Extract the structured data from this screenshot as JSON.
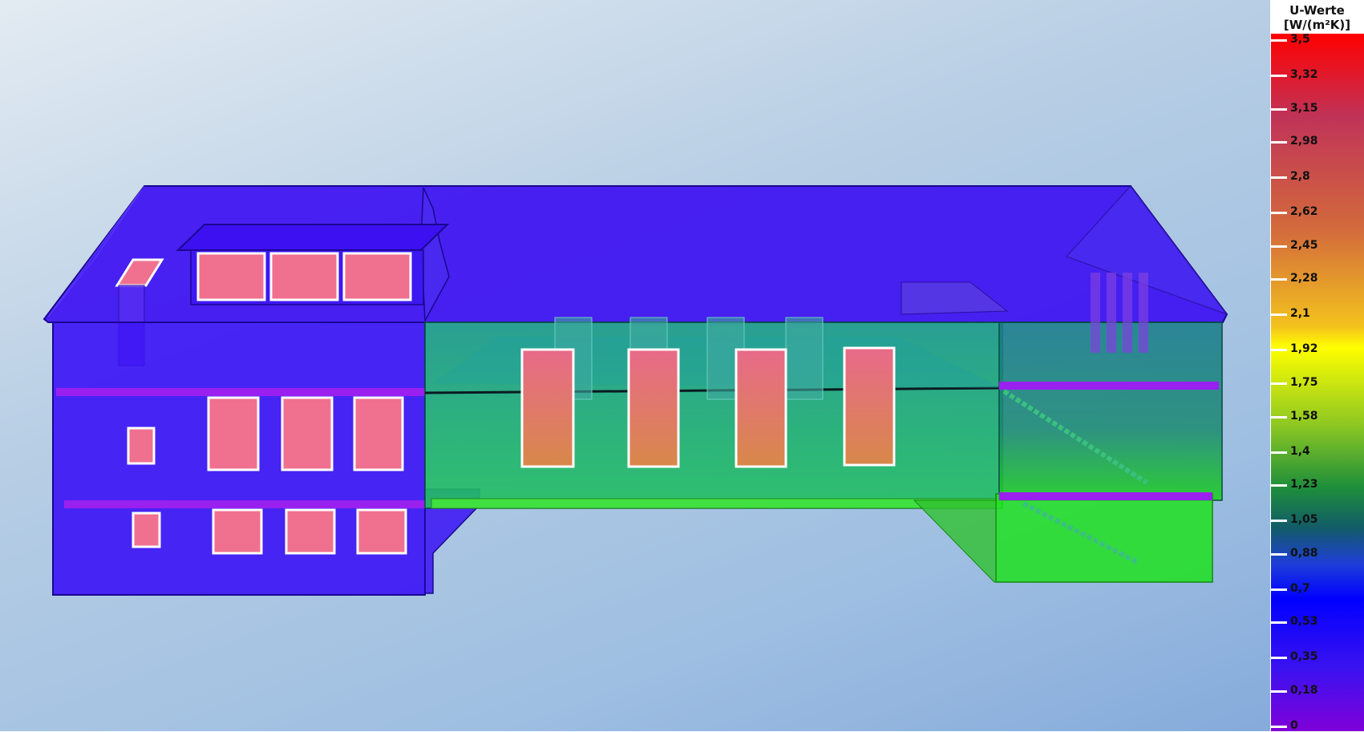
{
  "legend": {
    "title_line1": "U-Werte",
    "title_line2": "[W/(m²K)]",
    "unit": "W/(m²K)",
    "min": 0,
    "max": 3.5,
    "ticks": [
      {
        "label": "3,5",
        "value": 3.5
      },
      {
        "label": "3,32",
        "value": 3.32
      },
      {
        "label": "3,15",
        "value": 3.15
      },
      {
        "label": "2,98",
        "value": 2.98
      },
      {
        "label": "2,8",
        "value": 2.8
      },
      {
        "label": "2,62",
        "value": 2.62
      },
      {
        "label": "2,45",
        "value": 2.45
      },
      {
        "label": "2,28",
        "value": 2.28
      },
      {
        "label": "2,1",
        "value": 2.1
      },
      {
        "label": "1,92",
        "value": 1.92
      },
      {
        "label": "1,75",
        "value": 1.75
      },
      {
        "label": "1,58",
        "value": 1.58
      },
      {
        "label": "1,4",
        "value": 1.4
      },
      {
        "label": "1,23",
        "value": 1.23
      },
      {
        "label": "1,05",
        "value": 1.05
      },
      {
        "label": "0,88",
        "value": 0.88
      },
      {
        "label": "0,7",
        "value": 0.7
      },
      {
        "label": "0,53",
        "value": 0.53
      },
      {
        "label": "0,35",
        "value": 0.35
      },
      {
        "label": "0,18",
        "value": 0.18
      },
      {
        "label": "0",
        "value": 0
      }
    ],
    "colors": {
      "high": "#ff0000",
      "mid": "#ffff00",
      "green": "#1e8f3a",
      "low": "#0000ff",
      "min": "#8000d8"
    }
  },
  "model": {
    "wall_low_color": "#3a12f5",
    "wall_mid_color": "#1fa86a",
    "ground_floor_green": "#1ee01e",
    "window_color": "#f07090",
    "slab_color": "#9a20f0"
  }
}
